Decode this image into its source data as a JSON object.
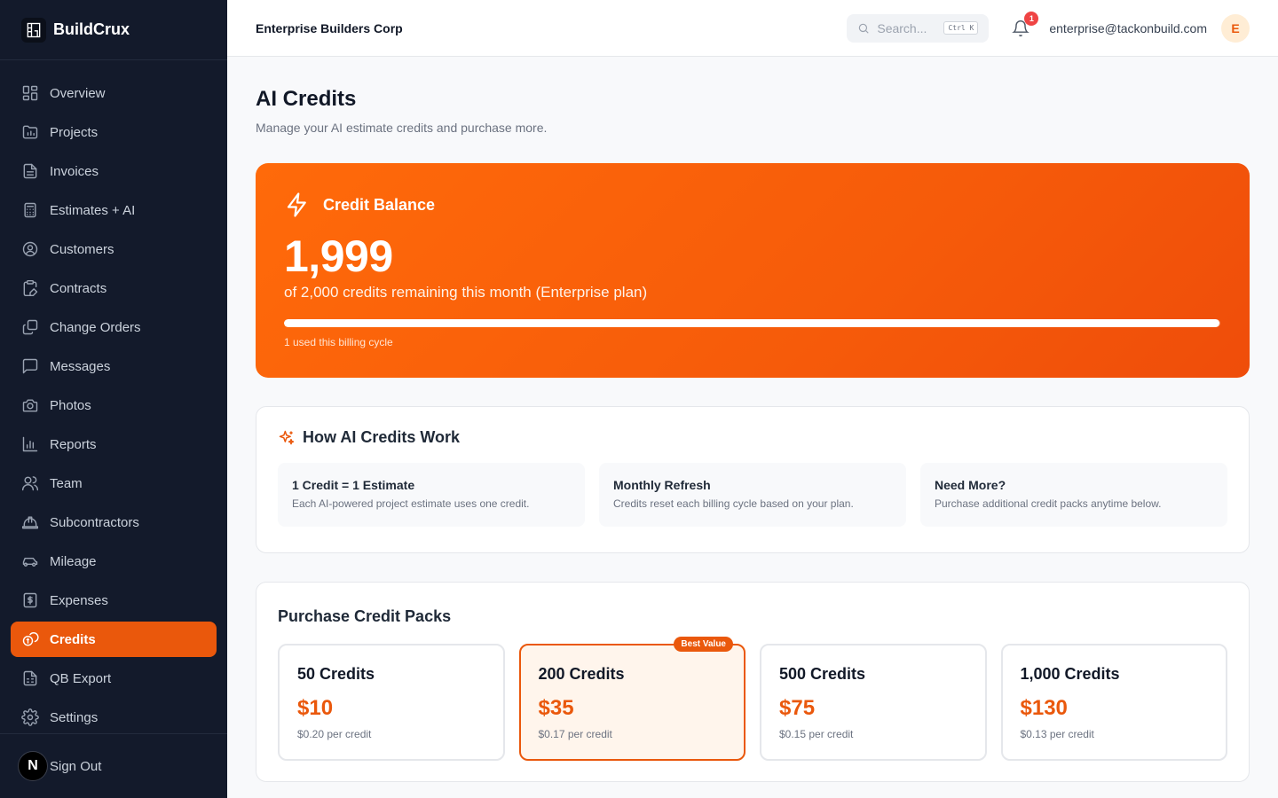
{
  "brand": {
    "name": "BuildCrux"
  },
  "sidebar": {
    "items": [
      {
        "label": "Overview",
        "icon": "grid-icon"
      },
      {
        "label": "Projects",
        "icon": "folder-chart-icon"
      },
      {
        "label": "Invoices",
        "icon": "document-icon"
      },
      {
        "label": "Estimates + AI",
        "icon": "calculator-icon"
      },
      {
        "label": "Customers",
        "icon": "user-circle-icon"
      },
      {
        "label": "Contracts",
        "icon": "clipboard-pen-icon"
      },
      {
        "label": "Change Orders",
        "icon": "copy-icon"
      },
      {
        "label": "Messages",
        "icon": "message-square-icon"
      },
      {
        "label": "Photos",
        "icon": "camera-icon"
      },
      {
        "label": "Reports",
        "icon": "bar-chart-icon"
      },
      {
        "label": "Team",
        "icon": "users-icon"
      },
      {
        "label": "Subcontractors",
        "icon": "hard-hat-icon"
      },
      {
        "label": "Mileage",
        "icon": "car-icon"
      },
      {
        "label": "Expenses",
        "icon": "receipt-dollar-icon"
      },
      {
        "label": "Credits",
        "icon": "coins-icon",
        "active": true
      },
      {
        "label": "QB Export",
        "icon": "spreadsheet-icon"
      },
      {
        "label": "Settings",
        "icon": "gear-icon"
      }
    ],
    "footer": {
      "badge": "N",
      "signout_label": "Sign Out"
    }
  },
  "header": {
    "company": "Enterprise Builders Corp",
    "search_placeholder": "Search...",
    "search_shortcut": "Ctrl K",
    "notification_count": "1",
    "email": "enterprise@tackonbuild.com",
    "avatar_initial": "E"
  },
  "page": {
    "title": "AI Credits",
    "subtitle": "Manage your AI estimate credits and purchase more."
  },
  "balance": {
    "title": "Credit Balance",
    "amount": "1,999",
    "description": "of 2,000 credits remaining this month (Enterprise plan)",
    "progress_fraction": 0.9995,
    "used_text": "1 used this billing cycle"
  },
  "how": {
    "title": "How AI Credits Work",
    "items": [
      {
        "title": "1 Credit = 1 Estimate",
        "desc": "Each AI-powered project estimate uses one credit."
      },
      {
        "title": "Monthly Refresh",
        "desc": "Credits reset each billing cycle based on your plan."
      },
      {
        "title": "Need More?",
        "desc": "Purchase additional credit packs anytime below."
      }
    ]
  },
  "packs": {
    "title": "Purchase Credit Packs",
    "best_label": "Best Value",
    "items": [
      {
        "name": "50 Credits",
        "price": "$10",
        "per": "$0.20 per credit"
      },
      {
        "name": "200 Credits",
        "price": "$35",
        "per": "$0.17 per credit",
        "best": true
      },
      {
        "name": "500 Credits",
        "price": "$75",
        "per": "$0.15 per credit"
      },
      {
        "name": "1,000 Credits",
        "price": "$130",
        "per": "$0.13 per credit"
      }
    ]
  },
  "colors": {
    "accent": "#ea580c",
    "sidebar_bg": "#131a2b",
    "badge_red": "#ef4444"
  }
}
